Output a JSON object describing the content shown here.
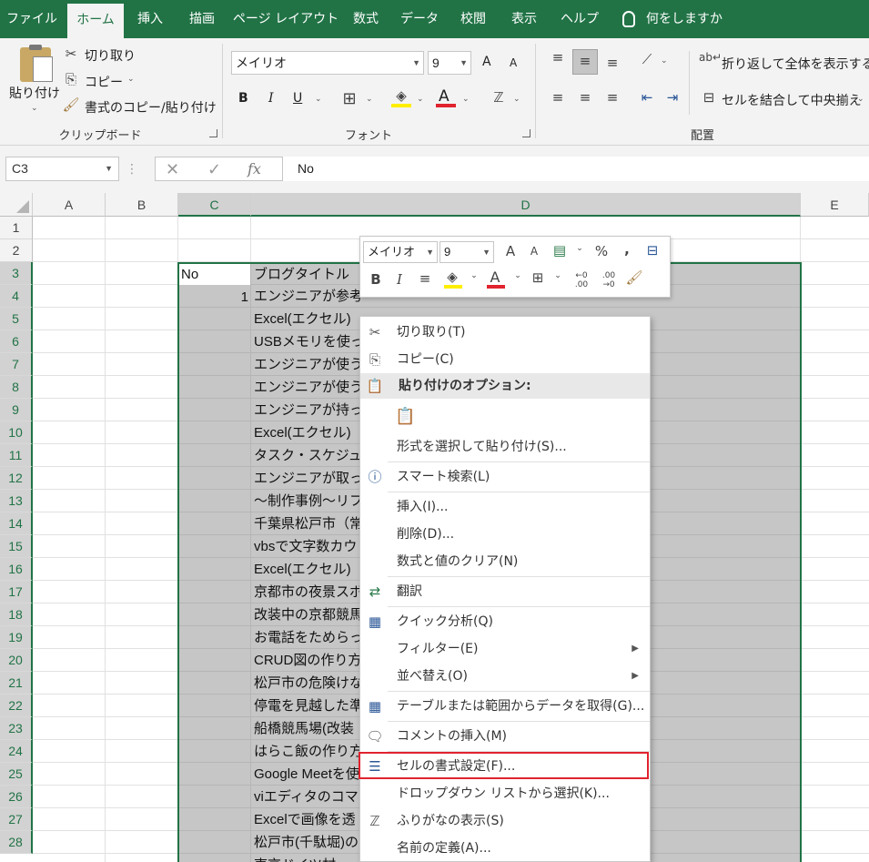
{
  "tabs": [
    {
      "label": "ファイル"
    },
    {
      "label": "ホーム",
      "active": true
    },
    {
      "label": "挿入"
    },
    {
      "label": "描画"
    },
    {
      "label": "ページ レイアウト"
    },
    {
      "label": "数式"
    },
    {
      "label": "データ"
    },
    {
      "label": "校閲"
    },
    {
      "label": "表示"
    },
    {
      "label": "ヘルプ"
    },
    {
      "label": "何をしますか"
    }
  ],
  "clipboard": {
    "paste": "貼り付け",
    "cut": "切り取り",
    "copy": "コピー",
    "format_painter": "書式のコピー/貼り付け",
    "group": "クリップボード"
  },
  "font": {
    "name": "メイリオ",
    "size": "9",
    "grow": "A",
    "shrink": "A",
    "bold": "B",
    "italic": "I",
    "underline": "U",
    "group": "フォント",
    "font_color_hex": "#e0232e",
    "fill_color_hex": "#ffee00"
  },
  "alignment": {
    "wrap_text": "折り返して全体を表示する",
    "merge_center": "セルを結合して中央揃え",
    "group": "配置"
  },
  "formula_bar": {
    "name_box": "C3",
    "fx": "fx",
    "content": "No"
  },
  "columns": [
    "A",
    "B",
    "C",
    "D",
    "E"
  ],
  "rows": [
    "1",
    "2",
    "3",
    "4",
    "5",
    "6",
    "7",
    "8",
    "9",
    "10",
    "11",
    "12",
    "13",
    "14",
    "15",
    "16",
    "17",
    "18",
    "19",
    "20",
    "21",
    "22",
    "23",
    "24",
    "25",
    "26",
    "27",
    "28"
  ],
  "cells": {
    "c3": "No",
    "d3": "ブログタイトル",
    "c4": "1",
    "d_values": [
      "エンジニアが参考",
      "Excel(エクセル)",
      "USBメモリを使っ",
      "エンジニアが使う",
      "エンジニアが使う",
      "エンジニアが持っ",
      "Excel(エクセル)",
      "タスク・スケジュ",
      "エンジニアが取っ",
      "～制作事例～リフ",
      "千葉県松戸市（常",
      "vbsで文字数カウ",
      "Excel(エクセル)",
      "京都市の夜景スポ",
      "改装中の京都競馬",
      "お電話をためらっ",
      "CRUD図の作り方",
      "松戸市の危険けな",
      "停電を見越した準",
      "船橋競馬場(改装",
      "はらこ飯の作り方",
      "Google Meetを使",
      "viエディタのコマ",
      "Excelで画像を透",
      "松戸市(千駄堀)の",
      "東京ドイツ村"
    ]
  },
  "mini_toolbar": {
    "font_name": "メイリオ",
    "font_size": "9",
    "percent": "%",
    "comma": ",",
    "bold": "B",
    "italic": "I",
    "dec_inc": "←0 .00",
    "dec_dec": ".00 →0"
  },
  "context_menu": {
    "cut": "切り取り(T)",
    "copy": "コピー(C)",
    "paste_options": "貼り付けのオプション:",
    "paste_special": "形式を選択して貼り付け(S)...",
    "smart_lookup": "スマート検索(L)",
    "insert": "挿入(I)...",
    "delete": "削除(D)...",
    "clear_contents": "数式と値のクリア(N)",
    "translate": "翻訳",
    "quick_analysis": "クイック分析(Q)",
    "filter": "フィルター(E)",
    "sort": "並べ替え(O)",
    "get_data": "テーブルまたは範囲からデータを取得(G)...",
    "insert_comment": "コメントの挿入(M)",
    "format_cells": "セルの書式設定(F)...",
    "pick_from_list": "ドロップダウン リストから選択(K)...",
    "phonetic": "ふりがなの表示(S)",
    "define_name": "名前の定義(A)..."
  },
  "colors": {
    "excel_green": "#217346",
    "highlight_red": "#e0232e",
    "selection_gray": "#c6c6c6"
  }
}
